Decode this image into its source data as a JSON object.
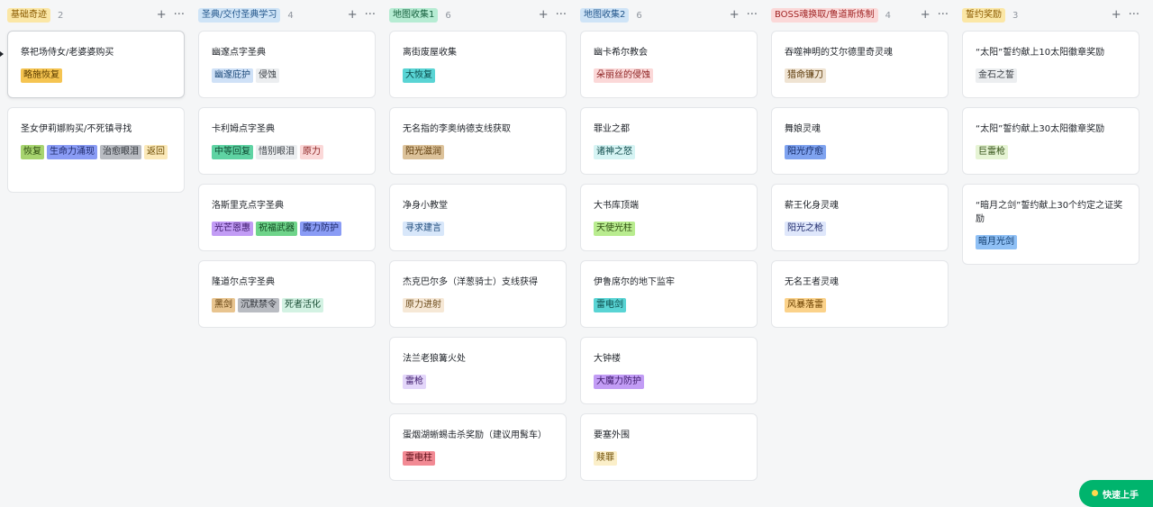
{
  "columns": [
    {
      "title": "基础奇迹",
      "count": "2",
      "title_bg": "#fbe7a6",
      "title_color": "#8a5a00",
      "cards": [
        {
          "title": "祭祀场侍女/老婆婆购买",
          "active": true,
          "height": 75,
          "tags": [
            {
              "text": "略施恢复",
              "bg": "#f5c451",
              "fg": "#5c3d00"
            }
          ]
        },
        {
          "title": "圣女伊莉娜购买/不死镇寻找",
          "height": 95,
          "tags": [
            {
              "text": "恢复",
              "bg": "#a7d46f",
              "fg": "#2f4d12"
            },
            {
              "text": "生命力涌现",
              "bg": "#8a9cf5",
              "fg": "#1f2a6b"
            },
            {
              "text": "治愈眼泪",
              "bg": "#b9bcc2",
              "fg": "#30343a"
            },
            {
              "text": "返回",
              "bg": "#fbe9b9",
              "fg": "#6b4a00"
            }
          ]
        }
      ]
    },
    {
      "title": "圣典/交付圣典学习",
      "count": "4",
      "title_bg": "#cfe4f7",
      "title_color": "#24578c",
      "cards": [
        {
          "title": "幽邃点字圣典",
          "height": 75,
          "tags": [
            {
              "text": "幽邃庇护",
              "bg": "#cfe1f7",
              "fg": "#1f4b7a"
            },
            {
              "text": "侵蚀",
              "bg": "#eceef0",
              "fg": "#3a3f45"
            }
          ]
        },
        {
          "title": "卡利姆点字圣典",
          "height": 75,
          "tags": [
            {
              "text": "中等回复",
              "bg": "#5fd3a3",
              "fg": "#0f4a32"
            },
            {
              "text": "惜别眼泪",
              "bg": "#eceef0",
              "fg": "#3a3f45"
            },
            {
              "text": "原力",
              "bg": "#fbd8d8",
              "fg": "#8a1f1f"
            }
          ]
        },
        {
          "title": "洛斯里克点字圣典",
          "height": 75,
          "tags": [
            {
              "text": "光芒恩惠",
              "bg": "#c29cf5",
              "fg": "#3d1a6b"
            },
            {
              "text": "祝福武器",
              "bg": "#6fd48a",
              "fg": "#124a22"
            },
            {
              "text": "魔力防护",
              "bg": "#8a9cf5",
              "fg": "#1f2a6b"
            }
          ]
        },
        {
          "title": "隆道尔点字圣典",
          "height": 75,
          "tags": [
            {
              "text": "黑剑",
              "bg": "#e8c48f",
              "fg": "#5c3a0a"
            },
            {
              "text": "沉默禁令",
              "bg": "#b9bcc2",
              "fg": "#30343a"
            },
            {
              "text": "死者活化",
              "bg": "#d3f2e3",
              "fg": "#1a4d35"
            }
          ]
        }
      ]
    },
    {
      "title": "地图收集1",
      "count": "6",
      "title_bg": "#b6ecd3",
      "title_color": "#17613f",
      "cards": [
        {
          "title": "离街废屋收集",
          "height": 75,
          "tags": [
            {
              "text": "大恢复",
              "bg": "#59d4d4",
              "fg": "#0a4a4a"
            }
          ]
        },
        {
          "title": "无名指的李奥纳德支线获取",
          "height": 75,
          "tags": [
            {
              "text": "阳光滋润",
              "bg": "#dcc29a",
              "fg": "#5c3a0a"
            }
          ]
        },
        {
          "title": "净身小教堂",
          "height": 75,
          "tags": [
            {
              "text": "寻求建言",
              "bg": "#d8e7fa",
              "fg": "#1f4b7a"
            }
          ]
        },
        {
          "title": "杰克巴尔多（洋葱骑士）支线获得",
          "height": 75,
          "tags": [
            {
              "text": "原力进射",
              "bg": "#f6e8d6",
              "fg": "#6b4a1a"
            }
          ]
        },
        {
          "title": "法兰老狼篝火处",
          "height": 75,
          "tags": [
            {
              "text": "雷枪",
              "bg": "#e3d6fa",
              "fg": "#3d1a6b"
            }
          ]
        },
        {
          "title": "蛋烟湖蜥蜴击杀奖励（建议用髯车）",
          "height": 75,
          "tags": [
            {
              "text": "雷电柱",
              "bg": "#f28a94",
              "fg": "#5c0f18"
            }
          ]
        }
      ]
    },
    {
      "title": "地图收集2",
      "count": "6",
      "title_bg": "#cfe4f7",
      "title_color": "#24578c",
      "cards": [
        {
          "title": "幽卡希尔教会",
          "height": 75,
          "tags": [
            {
              "text": "朵丽丝的侵蚀",
              "bg": "#fbd8d8",
              "fg": "#8a1f1f"
            }
          ]
        },
        {
          "title": "罪业之都",
          "height": 75,
          "tags": [
            {
              "text": "诸神之怒",
              "bg": "#d6f4f4",
              "fg": "#0f4a4a"
            }
          ]
        },
        {
          "title": "大书库顶端",
          "height": 75,
          "tags": [
            {
              "text": "天使光柱",
              "bg": "#b9ec8f",
              "fg": "#2f4d12"
            }
          ]
        },
        {
          "title": "伊鲁席尔的地下监牢",
          "height": 75,
          "tags": [
            {
              "text": "雷电剑",
              "bg": "#59d4d4",
              "fg": "#0a4a4a"
            }
          ]
        },
        {
          "title": "大钟楼",
          "height": 75,
          "tags": [
            {
              "text": "大魔力防护",
              "bg": "#c29cf5",
              "fg": "#3d1a6b"
            }
          ]
        },
        {
          "title": "要塞外围",
          "height": 75,
          "tags": [
            {
              "text": "赎罪",
              "bg": "#fbefc9",
              "fg": "#6b4a00"
            }
          ]
        }
      ]
    },
    {
      "title": "BOSS魂换取/鲁道斯炼制",
      "count": "4",
      "title_bg": "#fbd8d8",
      "title_color": "#a12626",
      "cards": [
        {
          "title": "吞噬神明的艾尔德里奇灵魂",
          "height": 75,
          "tags": [
            {
              "text": "猎命镰刀",
              "bg": "#efe3d2",
              "fg": "#5c3a0a"
            }
          ]
        },
        {
          "title": "舞娘灵魂",
          "height": 75,
          "tags": [
            {
              "text": "阳光疗愈",
              "bg": "#7fa3f0",
              "fg": "#142a66"
            }
          ]
        },
        {
          "title": "薪王化身灵魂",
          "height": 75,
          "tags": [
            {
              "text": "阳光之枪",
              "bg": "#dfe7fb",
              "fg": "#1f2a6b"
            }
          ]
        },
        {
          "title": "无名王者灵魂",
          "height": 75,
          "tags": [
            {
              "text": "风暴落雷",
              "bg": "#fbd28a",
              "fg": "#6b4000"
            }
          ]
        }
      ]
    },
    {
      "title": "誓约奖励",
      "count": "3",
      "title_bg": "#fbe7a6",
      "title_color": "#8a5a00",
      "cards": [
        {
          "title": "“太阳”誓约献上10太阳徽章奖励",
          "height": 75,
          "tags": [
            {
              "text": "金石之誓",
              "bg": "#eceef0",
              "fg": "#3a3f45"
            }
          ]
        },
        {
          "title": "“太阳”誓约献上30太阳徽章奖励",
          "height": 75,
          "tags": [
            {
              "text": "巨雷枪",
              "bg": "#e6f4d4",
              "fg": "#2f4d12"
            }
          ]
        },
        {
          "title": "“暗月之剑”誓约献上30个约定之证奖励",
          "height": 90,
          "tags": [
            {
              "text": "暗月光剑",
              "bg": "#8fc0f5",
              "fg": "#0f3a6b"
            }
          ]
        }
      ]
    }
  ],
  "actions": {
    "add": "+",
    "more": "···"
  },
  "quick_start": {
    "label": "快速上手"
  }
}
